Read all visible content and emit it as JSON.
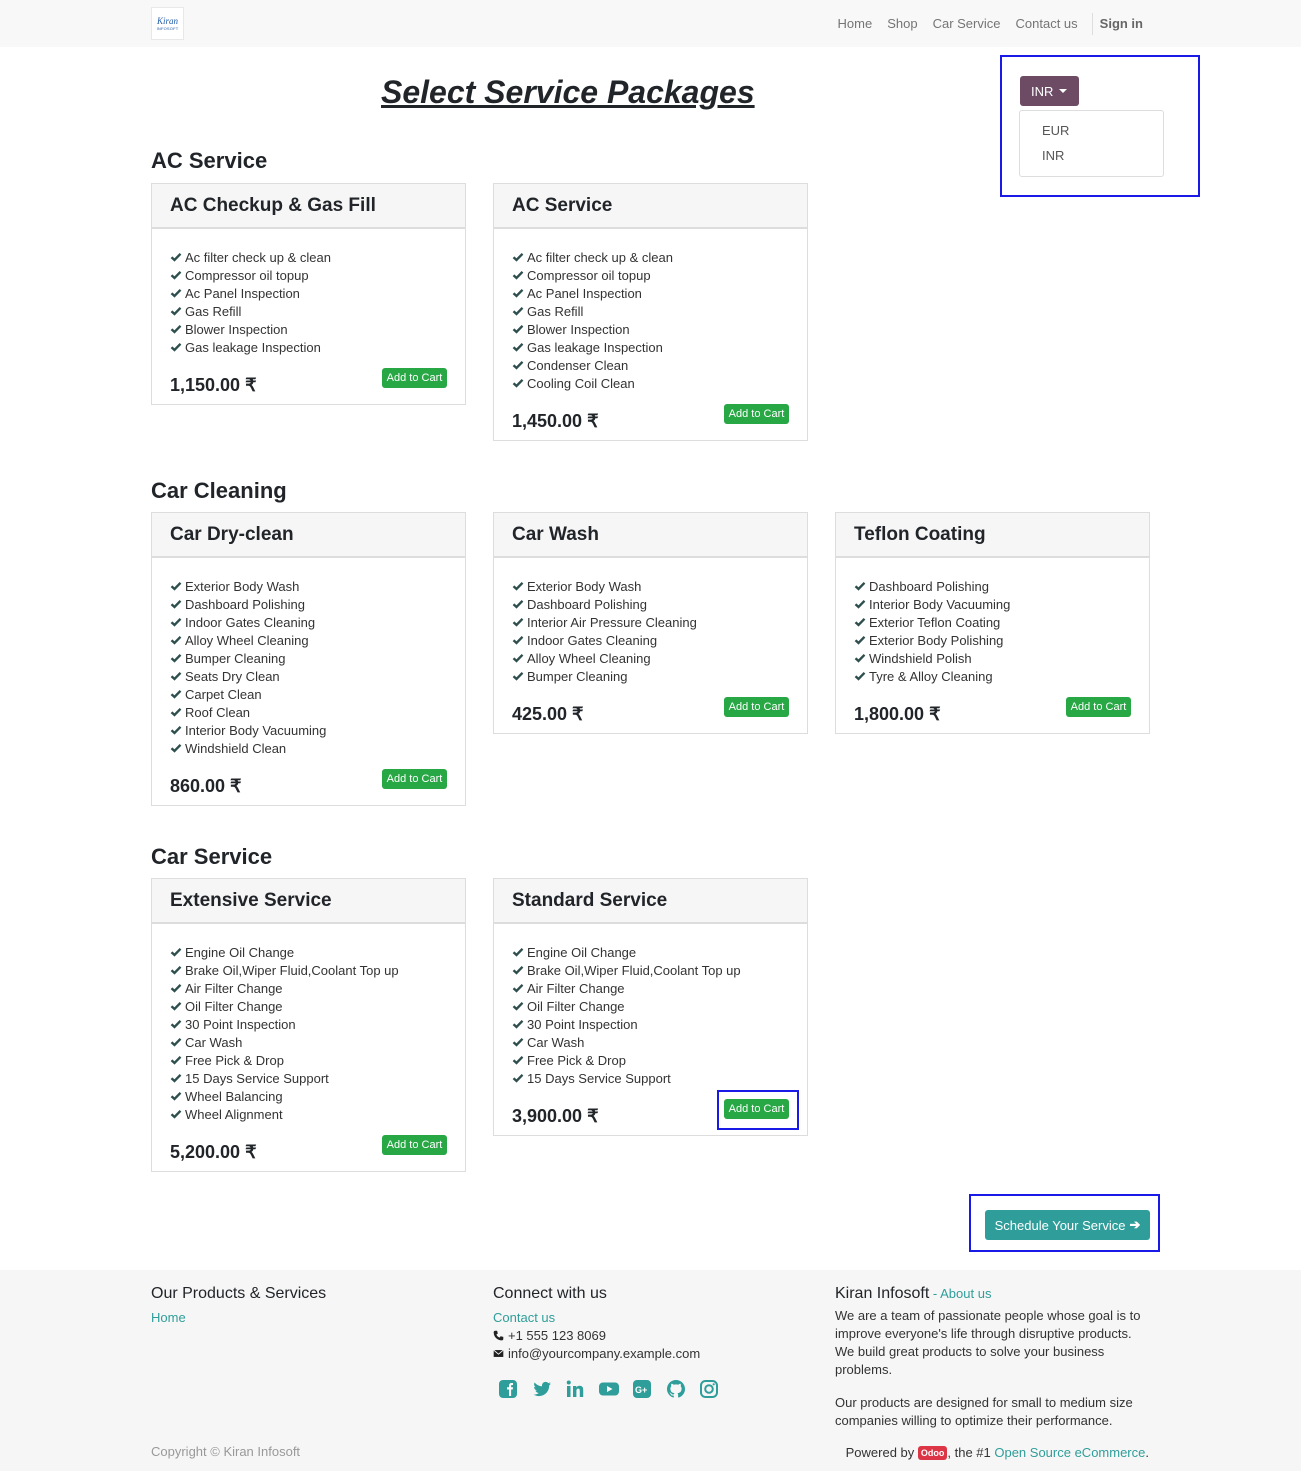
{
  "nav": {
    "logo_line1": "Kiran",
    "logo_line2": "INFOSOFT",
    "items": [
      "Home",
      "Shop",
      "Car Service",
      "Contact us"
    ],
    "signin": "Sign in"
  },
  "page_title": "Select Service Packages",
  "currency": {
    "selected": "INR",
    "options": [
      "EUR",
      "INR"
    ]
  },
  "add_to_cart_label": "Add to Cart",
  "sections": [
    {
      "title": "AC Service",
      "cards": [
        {
          "name": "AC Checkup & Gas Fill",
          "features": [
            "Ac filter check up & clean",
            "Compressor oil topup",
            "Ac Panel Inspection",
            "Gas Refill",
            "Blower Inspection",
            "Gas leakage Inspection"
          ],
          "price": "1,150.00 ₹"
        },
        {
          "name": "AC Service",
          "features": [
            "Ac filter check up & clean",
            "Compressor oil topup",
            "Ac Panel Inspection",
            "Gas Refill",
            "Blower Inspection",
            "Gas leakage Inspection",
            "Condenser Clean",
            "Cooling Coil Clean"
          ],
          "price": "1,450.00 ₹"
        }
      ]
    },
    {
      "title": "Car Cleaning",
      "cards": [
        {
          "name": "Car Dry-clean",
          "features": [
            "Exterior Body Wash",
            "Dashboard Polishing",
            "Indoor Gates Cleaning",
            "Alloy Wheel Cleaning",
            "Bumper Cleaning",
            "Seats Dry Clean",
            "Carpet Clean",
            "Roof Clean",
            "Interior Body Vacuuming",
            "Windshield Clean"
          ],
          "price": "860.00 ₹"
        },
        {
          "name": "Car Wash",
          "features": [
            "Exterior Body Wash",
            "Dashboard Polishing",
            "Interior Air Pressure Cleaning",
            "Indoor Gates Cleaning",
            "Alloy Wheel Cleaning",
            "Bumper Cleaning"
          ],
          "price": "425.00 ₹"
        },
        {
          "name": "Teflon Coating",
          "features": [
            "Dashboard Polishing",
            "Interior Body Vacuuming",
            "Exterior Teflon Coating",
            "Exterior Body Polishing",
            "Windshield Polish",
            "Tyre & Alloy Cleaning"
          ],
          "price": "1,800.00 ₹"
        }
      ]
    },
    {
      "title": "Car Service",
      "cards": [
        {
          "name": "Extensive Service",
          "features": [
            "Engine Oil Change",
            "Brake Oil,Wiper Fluid,Coolant Top up",
            "Air Filter Change",
            "Oil Filter Change",
            "30 Point Inspection",
            "Car Wash",
            "Free Pick & Drop",
            "15 Days Service Support",
            "Wheel Balancing",
            "Wheel Alignment"
          ],
          "price": "5,200.00 ₹"
        },
        {
          "name": "Standard Service",
          "features": [
            "Engine Oil Change",
            "Brake Oil,Wiper Fluid,Coolant Top up",
            "Air Filter Change",
            "Oil Filter Change",
            "30 Point Inspection",
            "Car Wash",
            "Free Pick & Drop",
            "15 Days Service Support"
          ],
          "price": "3,900.00 ₹"
        }
      ]
    }
  ],
  "schedule_button": "Schedule Your Service",
  "footer": {
    "col1": {
      "title": "Our Products & Services",
      "links": [
        "Home"
      ]
    },
    "col2": {
      "title": "Connect with us",
      "contact_link": "Contact us",
      "phone": "+1 555 123 8069",
      "email": "info@yourcompany.example.com",
      "social_icons": [
        "facebook-icon",
        "twitter-icon",
        "linkedin-icon",
        "youtube-icon",
        "google-plus-icon",
        "github-icon",
        "instagram-icon"
      ]
    },
    "col3": {
      "title": "Kiran Infosoft",
      "title_sep": " - ",
      "about_link": "About us",
      "para1": "We are a team of passionate people whose goal is to improve everyone's life through disruptive products. We build great products to solve your business problems.",
      "para2": "Our products are designed for small to medium size companies willing to optimize their performance."
    },
    "copyright": "Copyright © Kiran Infosoft",
    "powered_prefix": "Powered by ",
    "powered_badge": "Odoo",
    "powered_mid": ", the #1 ",
    "powered_link": "Open Source eCommerce",
    "powered_suffix": "."
  },
  "colors": {
    "accent": "#2f9e9a",
    "currency_button": "#6d4b65",
    "add_to_cart": "#28a745",
    "highlight_border": "#1a1ae6",
    "odoo_badge": "#dc3545"
  }
}
